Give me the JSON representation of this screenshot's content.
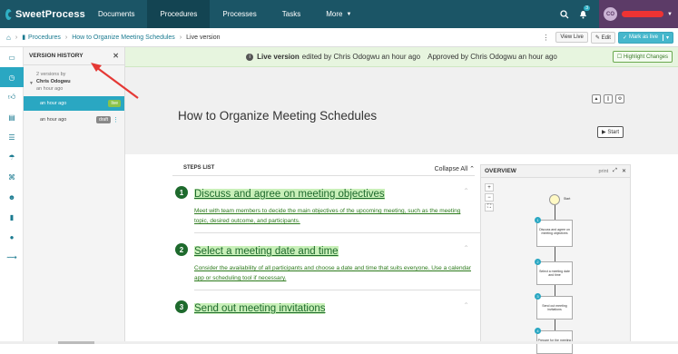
{
  "app": {
    "logo": "SweetProcess"
  },
  "topnav": {
    "items": [
      "Documents",
      "Procedures",
      "Processes",
      "Tasks",
      "More"
    ],
    "active_index": 1,
    "notifications_count": "3",
    "user_initials": "CO"
  },
  "breadcrumb": {
    "items": [
      "Procedures",
      "How to Organize Meeting Schedules",
      "Live version"
    ],
    "actions": {
      "view_live": "View Live",
      "edit": "Edit",
      "mark_as_live": "Mark as live"
    }
  },
  "version_history": {
    "title": "VERSION HISTORY",
    "group": {
      "count_label": "2 versions by",
      "author": "Chris Odogwu",
      "time": "an hour ago"
    },
    "versions": [
      {
        "time": "an hour ago",
        "tag": "live"
      },
      {
        "time": "an hour ago",
        "tag": "draft"
      }
    ]
  },
  "banner": {
    "text_live": "Live version",
    "text_edited": "edited by Chris Odogwu an hour ago",
    "text_approved": "Approved by Chris Odogwu an hour ago",
    "highlight_btn": "Highlight Changes"
  },
  "procedure": {
    "title": "How to Organize Meeting Schedules",
    "start_btn": "Start"
  },
  "steps_list": {
    "label": "STEPS LIST",
    "collapse": "Collapse All",
    "steps": [
      {
        "num": "1",
        "title": "Discuss and agree on meeting objectives",
        "desc": "Meet with team members to decide the main objectives of the upcoming meeting, such as the meeting topic, desired outcome, and participants."
      },
      {
        "num": "2",
        "title": "Select a meeting date and time",
        "desc": "Consider the availability of all participants and choose a date and time that suits everyone. Use a calendar app or scheduling tool if necessary."
      },
      {
        "num": "3",
        "title": "Send out meeting invitations",
        "desc": ""
      }
    ]
  },
  "overview": {
    "title": "OVERVIEW",
    "print": "print",
    "flow": {
      "start_label": "Start",
      "nodes": [
        {
          "num": "1",
          "label": "Discuss and agree on meeting objectives"
        },
        {
          "num": "2",
          "label": "Select a meeting date and time"
        },
        {
          "num": "3",
          "label": "Send out meeting invitations"
        },
        {
          "num": "4",
          "label": "Prepare for the meeting"
        }
      ]
    }
  },
  "colors": {
    "primary": "#1b5566",
    "accent": "#2aa7c2",
    "step_green": "#1e6a2d",
    "banner_bg": "#e7f5df",
    "annotation_red": "#e53935"
  }
}
